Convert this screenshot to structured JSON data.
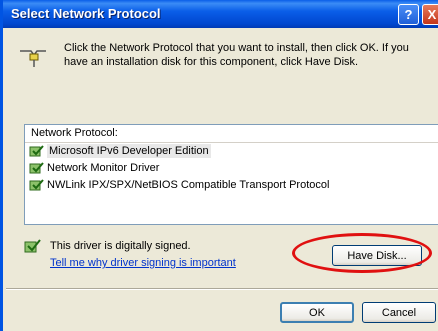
{
  "dialog": {
    "title": "Select Network Protocol",
    "help_glyph": "?",
    "close_glyph": "X"
  },
  "intro": {
    "text": "Click the Network Protocol that you want to install, then click OK. If you have an installation disk for this component, click Have Disk."
  },
  "list": {
    "header": "Network Protocol:",
    "items": [
      {
        "label": "Microsoft IPv6 Developer Edition",
        "selected": true
      },
      {
        "label": "Network Monitor Driver",
        "selected": false
      },
      {
        "label": "NWLink IPX/SPX/NetBIOS Compatible Transport Protocol",
        "selected": false
      }
    ]
  },
  "signing": {
    "status": "This driver is digitally signed.",
    "link": "Tell me why driver signing is important"
  },
  "buttons": {
    "have_disk": "Have Disk...",
    "ok": "OK",
    "cancel": "Cancel"
  },
  "colors": {
    "titlebar": "#0a5ee8",
    "highlight_ring": "#e01010",
    "link": "#0033cc"
  }
}
